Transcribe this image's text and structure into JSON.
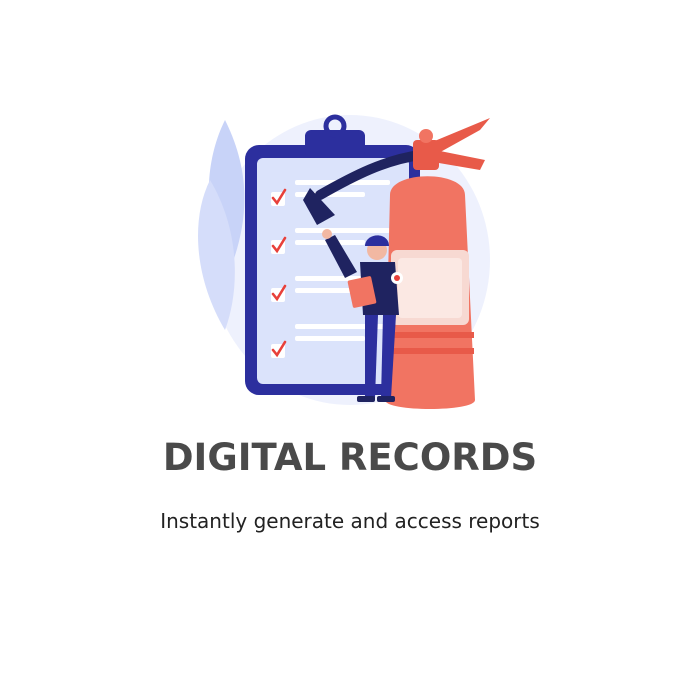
{
  "card": {
    "title": "DIGITAL RECORDS",
    "subtitle": "Instantly generate and access reports"
  },
  "illustration": {
    "icon": "fire-extinguisher-checklist-illustration",
    "colors": {
      "clipboard_frame": "#2c2f9e",
      "clipboard_paper": "#dbe3fb",
      "check": "#e8403a",
      "extinguisher": "#f17462",
      "extinguisher_dark": "#e85a49",
      "leaf": "#c8d3f8",
      "backdrop": "#eef1fd",
      "worker_uniform": "#1f2360"
    }
  }
}
